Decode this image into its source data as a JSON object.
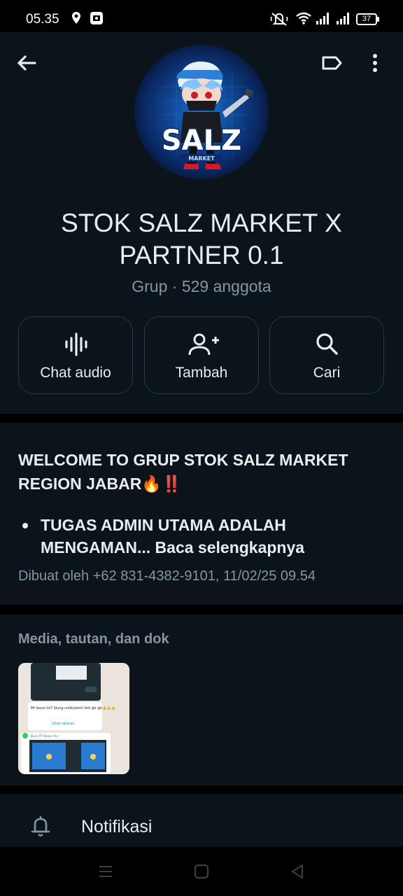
{
  "status_bar": {
    "time": "05.35",
    "battery": "37",
    "icons": [
      "location-icon",
      "screenshot-icon",
      "mute-icon",
      "wifi-icon",
      "signal-icon",
      "signal-icon"
    ]
  },
  "header": {
    "icons": [
      "back-arrow-icon",
      "label-icon",
      "more-vert-icon"
    ],
    "avatar_text": "SALZ",
    "avatar_sub": "MARKET",
    "group_name": "STOK SALZ MARKET X PARTNER 0.1",
    "group_sub": "Grup · 529 anggota"
  },
  "actions": [
    {
      "label": "Chat audio",
      "icon": "audio-wave-icon"
    },
    {
      "label": "Tambah",
      "icon": "add-person-icon"
    },
    {
      "label": "Cari",
      "icon": "search-icon"
    }
  ],
  "description": {
    "title": "WELCOME TO GRUP STOK SALZ MARKET REGION JABAR🔥‼️",
    "bullet": "TUGAS ADMIN UTAMA ADALAH MENGAMAN... Baca selengkapnya",
    "meta": "Dibuat oleh +62 831-4382-9101, 11/02/25 09.54"
  },
  "media": {
    "title": "Media, tautan, dan dok",
    "thumb_caption": "Mr bozzi ini? Siung culik/semil link gb ajk👍👍👍",
    "thumb_link": "Lihat saluran",
    "thumb_header": "Bulc PT Kesen Hu"
  },
  "notifications": {
    "label": "Notifikasi",
    "icon": "bell-icon"
  },
  "nav": {
    "icons": [
      "recents-icon",
      "home-icon",
      "back-triangle-icon"
    ]
  },
  "colors": {
    "background": "#0b141a",
    "text": "#e9edef",
    "muted": "#8696a0",
    "border": "#2a3942"
  }
}
